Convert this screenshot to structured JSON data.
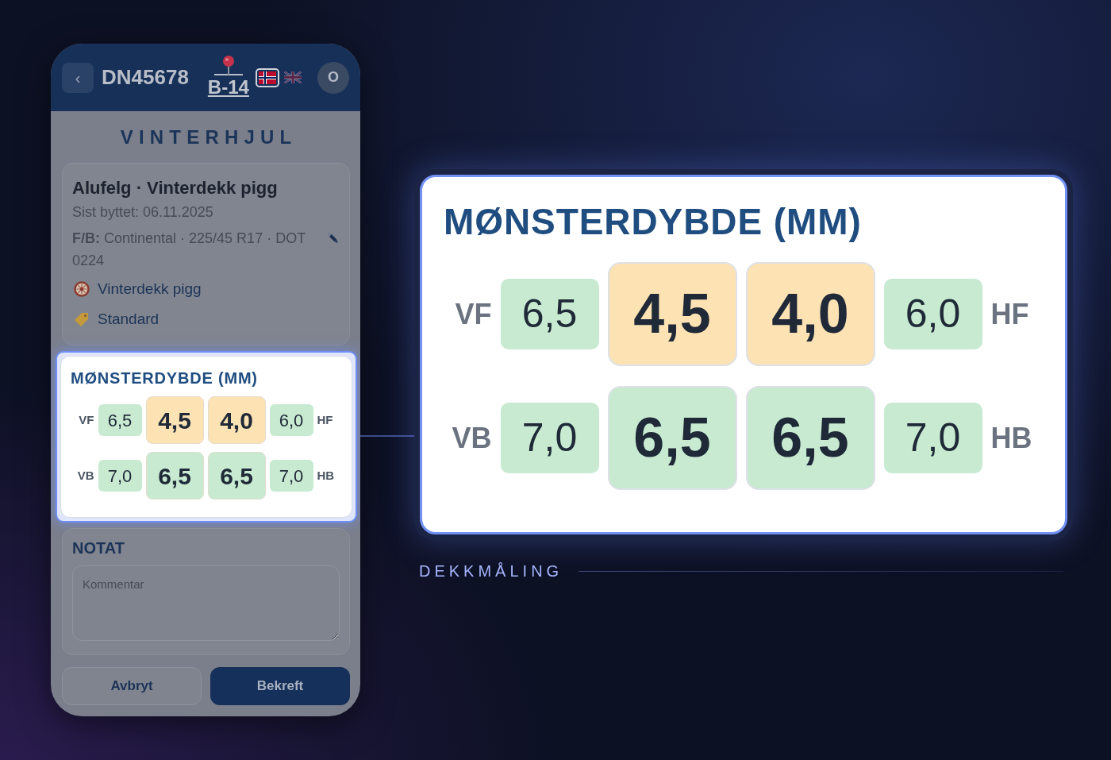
{
  "phone": {
    "header": {
      "back": "‹",
      "order_number": "DN45678",
      "location": "B-14",
      "languages": [
        {
          "kind": "no",
          "selected": true
        },
        {
          "kind": "gb",
          "selected": false
        }
      ],
      "avatar": "O"
    },
    "title": "VINTERHJUL",
    "wheel_card": {
      "title": "Alufelg · Vinterdekk pigg",
      "last_changed": "Sist byttet: 06.11.2025",
      "tire_info": "**F/B:** Continental · 225/45 R17 · DOT 0224",
      "tags": [
        {
          "kind": "tire",
          "label": "Vinterdekk pigg"
        },
        {
          "kind": "tag",
          "label": "Standard"
        }
      ]
    },
    "tread_card": {
      "highlighted": true,
      "title": "MØNSTERDYBDE (MM)",
      "rows": [
        {
          "left": "VF",
          "right": "HF",
          "cells": [
            {
              "value": "6,5",
              "warning": false
            },
            {
              "value": "4,5",
              "warning": true
            },
            {
              "value": "4,0",
              "warning": true
            },
            {
              "value": "6,0",
              "warning": false
            }
          ]
        },
        {
          "left": "VB",
          "right": "HB",
          "cells": [
            {
              "value": "7,0",
              "warning": false
            },
            {
              "value": "6,5",
              "warning": false
            },
            {
              "value": "6,5",
              "warning": false
            },
            {
              "value": "7,0",
              "warning": false
            }
          ]
        }
      ]
    },
    "note": {
      "title": "NOTAT",
      "placeholder": "Kommentar"
    },
    "buttons": [
      {
        "kind": "secondary",
        "label": "Avbryt"
      },
      {
        "kind": "primary",
        "label": "Bekreft"
      }
    ]
  },
  "callout": {
    "title": "MØNSTERDYBDE (MM)",
    "rows": [
      {
        "left": "VF",
        "right": "HF",
        "cells": [
          {
            "value": "6,5",
            "warning": false
          },
          {
            "value": "4,5",
            "warning": true
          },
          {
            "value": "4,0",
            "warning": true
          },
          {
            "value": "6,0",
            "warning": false
          }
        ]
      },
      {
        "left": "VB",
        "right": "HB",
        "cells": [
          {
            "value": "7,0",
            "warning": false
          },
          {
            "value": "6,5",
            "warning": false
          },
          {
            "value": "6,5",
            "warning": false
          },
          {
            "value": "7,0",
            "warning": false
          }
        ]
      }
    ],
    "caption": "DEKKMÅLING"
  }
}
